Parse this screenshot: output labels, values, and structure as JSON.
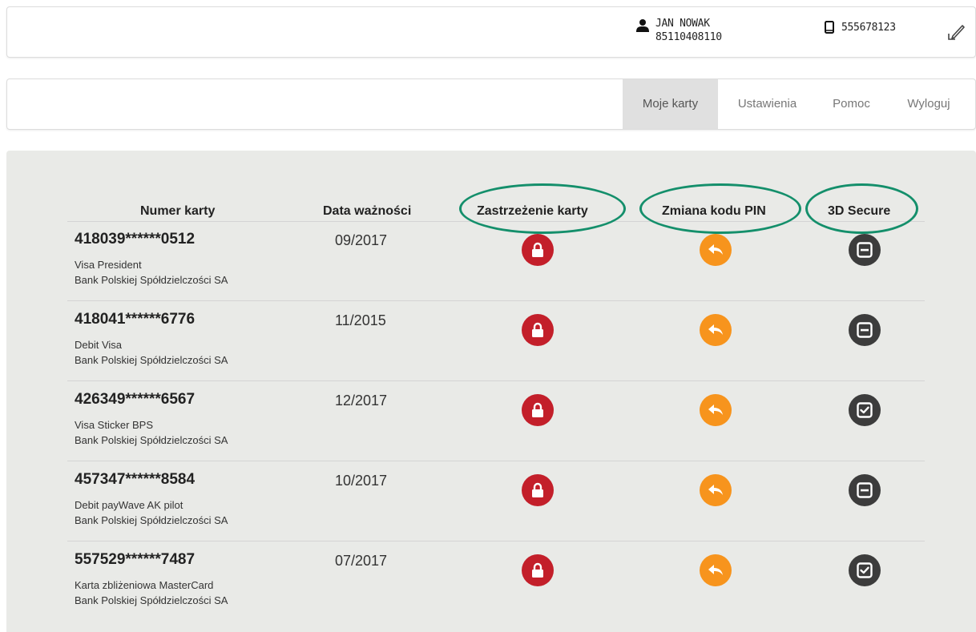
{
  "user": {
    "name": "JAN NOWAK",
    "id": "85110408110",
    "phone": "555678123"
  },
  "nav": {
    "items": [
      "Moje karty",
      "Ustawienia",
      "Pomoc",
      "Wyloguj"
    ],
    "active": "Moje karty"
  },
  "table": {
    "headers": [
      "Numer karty",
      "Data ważności",
      "Zastrzeżenie karty",
      "Zmiana kodu PIN",
      "3D Secure"
    ],
    "rows": [
      {
        "number": "418039******0512",
        "type": "Visa President",
        "bank": "Bank Polskiej Spółdzielczości SA",
        "expiry": "09/2017",
        "secure3d": "off"
      },
      {
        "number": "418041******6776",
        "type": "Debit Visa",
        "bank": "Bank Polskiej Spółdzielczości SA",
        "expiry": "11/2015",
        "secure3d": "off"
      },
      {
        "number": "426349******6567",
        "type": "Visa Sticker BPS",
        "bank": "Bank Polskiej Spółdzielczości SA",
        "expiry": "12/2017",
        "secure3d": "on"
      },
      {
        "number": "457347******8584",
        "type": "Debit payWave AK pilot",
        "bank": "Bank Polskiej Spółdzielczości SA",
        "expiry": "10/2017",
        "secure3d": "off"
      },
      {
        "number": "557529******7487",
        "type": "Karta zbliżeniowa MasterCard",
        "bank": "Bank Polskiej Spółdzielczości SA",
        "expiry": "07/2017",
        "secure3d": "on"
      }
    ]
  },
  "icons": {
    "user": "user-icon",
    "phone": "phone-icon",
    "edit": "edit-icon",
    "block_card": "lock-icon",
    "change_pin": "reply-arrow-icon",
    "secure3d_off": "minus-box-icon",
    "secure3d_on": "check-box-icon"
  },
  "colors": {
    "highlight_oval": "#148f6b",
    "lock": "#c31f2a",
    "pin": "#f7941d",
    "secure3d": "#3c3c3c",
    "content_bg": "#e9eae7",
    "nav_active_bg": "#e0e0e0"
  }
}
